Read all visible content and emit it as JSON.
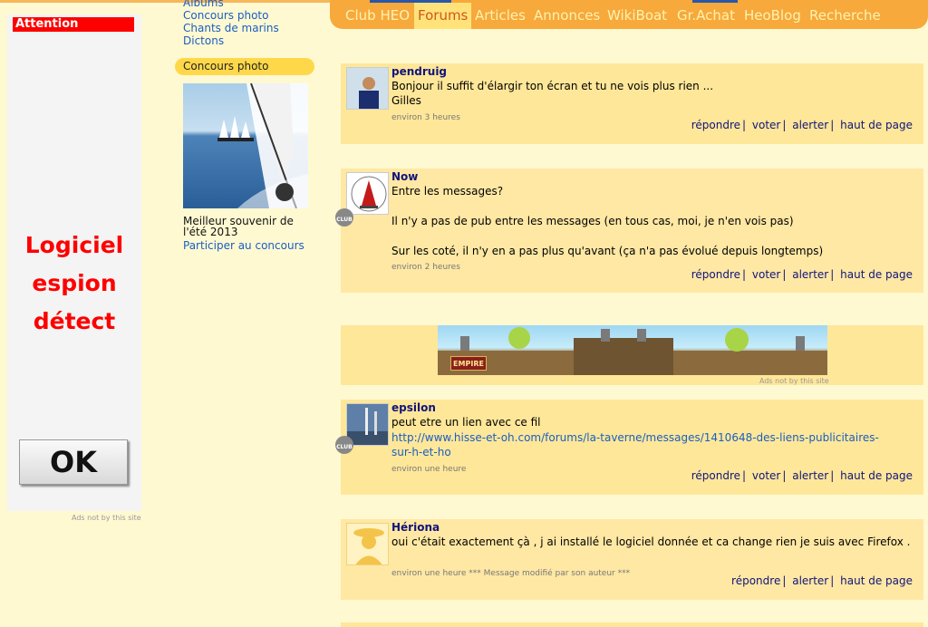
{
  "ad_left": {
    "attention": "Attention",
    "spy_lines": [
      "Logiciel",
      "espion",
      "détect"
    ],
    "ok_label": "OK",
    "ads_note": "Ads not by this site"
  },
  "sidebar": {
    "links": [
      "Albums",
      "Concours photo",
      "Chants de marins",
      "Dictons"
    ],
    "concours_heading": "Concours photo",
    "caption": "Meilleur souvenir de l'été 2013",
    "participer": "Participer au concours"
  },
  "nav": {
    "items": [
      "Club HEO",
      "Forums",
      "Articles",
      "Annonces",
      "WikiBoat",
      "Gr.Achat",
      "HeoBlog",
      "Recherche"
    ],
    "active": "Forums"
  },
  "posts": [
    {
      "author": "pendruig",
      "lines": [
        "Bonjour il suffit d'élargir ton écran et tu ne vois plus rien ...",
        "Gilles"
      ],
      "meta": "environ 3 heures",
      "actions": [
        "répondre",
        "voter",
        "alerter",
        "haut de page"
      ]
    },
    {
      "author": "Now",
      "badge": "CLUB",
      "lines": [
        "Entre les messages?",
        "",
        "Il n'y a pas de pub entre les messages (en tous cas, moi, je n'en vois pas)",
        "",
        "Sur les coté, il n'y en a pas plus qu'avant (ça n'a pas évolué depuis longtemps)"
      ],
      "meta": "environ 2 heures",
      "actions": [
        "répondre",
        "voter",
        "alerter",
        "haut de page"
      ]
    },
    {
      "author": "epsilon",
      "badge": "CLUB",
      "lines": [
        "peut etre un lien avec ce fil",
        "http://www.hisse-et-oh.com/forums/la-taverne/messages/1410648-des-liens-publicitaires-",
        "sur-h-et-ho"
      ],
      "meta": "environ une heure",
      "actions": [
        "répondre",
        "voter",
        "alerter",
        "haut de page"
      ]
    },
    {
      "author": "Hériona",
      "lines": [
        "oui c'était exactement çà , j ai installé le logiciel donnée et ca change rien je suis avec Firefox ."
      ],
      "meta": "environ une heure *** Message modifié par son auteur ***",
      "actions": [
        "répondre",
        "alerter",
        "haut de page"
      ]
    }
  ],
  "banner": {
    "logo_text": "EMPIRE",
    "ads_note": "Ads not by this site"
  }
}
